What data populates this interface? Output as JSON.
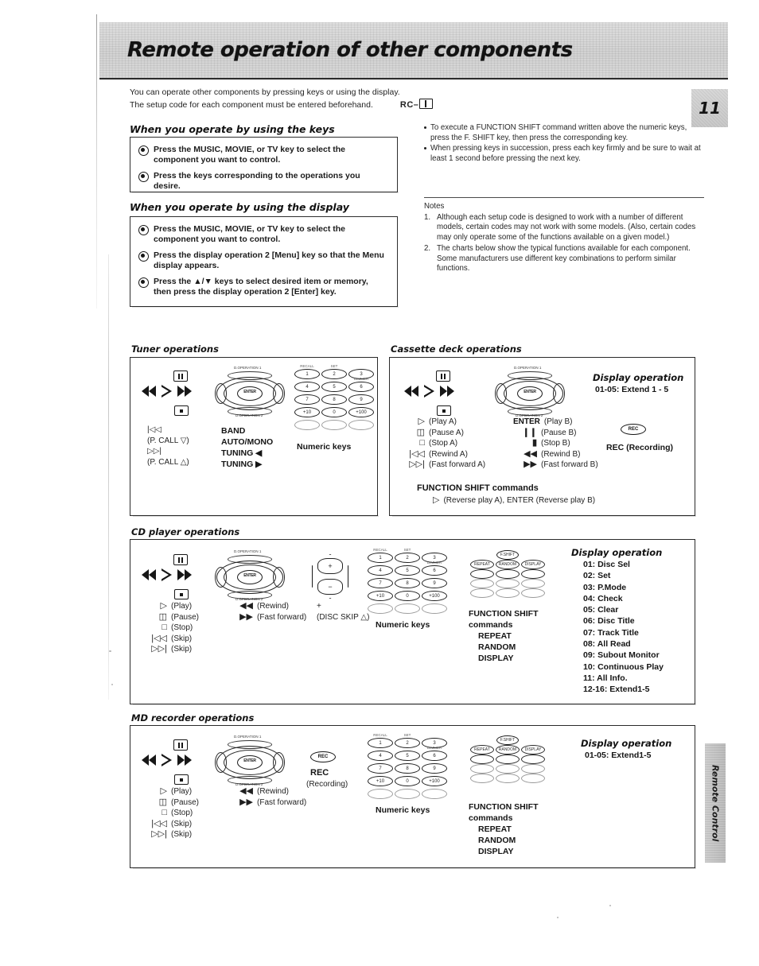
{
  "page": {
    "banner_title": "Remote operation of other components",
    "page_number": "11",
    "side_tab": "Remote Control"
  },
  "intro": {
    "line1": "You can operate other components by pressing keys or using the display.",
    "line2": "The setup code for each component must be entered beforehand.",
    "rc_code": "RC–"
  },
  "keys_section": {
    "title": "When you operate by using the keys",
    "steps": [
      "Press the MUSIC, MOVIE, or TV key to select the component you want to control.",
      "Press the keys corresponding to the operations you desire."
    ]
  },
  "display_section": {
    "title": "When you operate by using the display",
    "steps": [
      "Press the MUSIC, MOVIE, or TV key to select the component you want to control.",
      "Press the display operation 2 [Menu] key so that the Menu display appears.",
      "Press the ▲/▼ keys to select desired item or memory, then press the display operation 2 [Enter] key."
    ]
  },
  "right_notes": {
    "bullets": [
      "To execute a FUNCTION SHIFT command written above the numeric keys, press the F. SHIFT key, then press the corresponding key.",
      "When pressing keys in succession, press each key firmly and be sure to wait at least 1 second before pressing the next key."
    ],
    "notes_heading": "Notes",
    "notes": [
      {
        "n": "1.",
        "text": "Although each setup code is designed to work with a number of different models, certain codes may not work with some models.  (Also, certain codes may only operate some of the functions available on a given model.)"
      },
      {
        "n": "2.",
        "text": "The charts below show the typical functions available for each component.  Some manufacturers use different key combinations to perform similar functions."
      }
    ]
  },
  "tuner": {
    "label": "Tuner operations",
    "left_list": [
      "|◁◁",
      "(P. CALL ▽)",
      "▷▷|",
      "(P. CALL △)"
    ],
    "center_list": [
      "BAND",
      "AUTO/MONO",
      "TUNING ◀",
      "TUNING ▶"
    ],
    "numeric_caption": "Numeric keys"
  },
  "cassette": {
    "label": "Cassette deck operations",
    "col_a": [
      {
        "icon": "play",
        "text": "(Play A)"
      },
      {
        "icon": "pause",
        "text": "(Pause A)"
      },
      {
        "icon": "stop",
        "text": "(Stop A)"
      },
      {
        "icon": "rewind",
        "text": "(Rewind A)"
      },
      {
        "icon": "ffwd",
        "text": "(Fast forward A)"
      }
    ],
    "col_b": [
      {
        "icon": "enter",
        "label": "ENTER",
        "text": "(Play B)"
      },
      {
        "icon": "pause2",
        "text": "(Pause B)"
      },
      {
        "icon": "stop2",
        "text": "(Stop B)"
      },
      {
        "icon": "rewind2",
        "text": "(Rewind B)"
      },
      {
        "icon": "ffwd2",
        "text": "(Fast forward B)"
      }
    ],
    "rec_badge": "REC",
    "rec_caption": "REC (Recording)",
    "fshift_title": "FUNCTION SHIFT commands",
    "fshift_line": "(Reverse play A), ENTER (Reverse play B)",
    "display_title": "Display operation",
    "display_sub": "01-05: Extend 1 - 5"
  },
  "cd": {
    "label": "CD player operations",
    "col_a": [
      {
        "icon": "play",
        "text": "(Play)"
      },
      {
        "icon": "pause",
        "text": "(Pause)"
      },
      {
        "icon": "stop",
        "text": "(Stop)"
      },
      {
        "icon": "skipb",
        "text": "(Skip)"
      },
      {
        "icon": "skipf",
        "text": "(Skip)"
      }
    ],
    "col_b": [
      {
        "icon": "rewind2",
        "text": "(Rewind)"
      },
      {
        "icon": "ffwd2",
        "text": "(Fast forward)"
      }
    ],
    "disc_skip_plus": "+",
    "disc_skip_caption": "(DISC SKIP △)",
    "numeric_caption": "Numeric keys",
    "fshift_lines": [
      "FUNCTION SHIFT",
      "commands",
      "REPEAT",
      "RANDOM",
      "DISPLAY"
    ],
    "display_title": "Display operation",
    "display_items": [
      "01: Disc Sel",
      "02: Set",
      "03: P.Mode",
      "04: Check",
      "05: Clear",
      "06: Disc Title",
      "07: Track Title",
      "08: All Read",
      "09: Subout Monitor",
      "10: Continuous Play",
      "11: All Info.",
      "12-16: Extend1-5"
    ]
  },
  "md": {
    "label": "MD recorder operations",
    "col_a": [
      {
        "icon": "play",
        "text": "(Play)"
      },
      {
        "icon": "pause",
        "text": "(Pause)"
      },
      {
        "icon": "stop",
        "text": "(Stop)"
      },
      {
        "icon": "skipb",
        "text": "(Skip)"
      },
      {
        "icon": "skipf",
        "text": "(Skip)"
      }
    ],
    "col_b": [
      {
        "icon": "rewind2",
        "text": "(Rewind)"
      },
      {
        "icon": "ffwd2",
        "text": "(Fast forward)"
      }
    ],
    "rec_badge": "REC",
    "rec_label": "REC",
    "rec_caption": "(Recording)",
    "numeric_caption": "Numeric keys",
    "fshift_lines": [
      "FUNCTION SHIFT",
      "commands",
      "REPEAT",
      "RANDOM",
      "DISPLAY"
    ],
    "display_title": "Display operation",
    "display_sub": "01-05: Extend1-5"
  },
  "keypad_rows": [
    [
      "1",
      "2",
      "3"
    ],
    [
      "4",
      "5",
      "6"
    ],
    [
      "7",
      "8",
      "9"
    ],
    [
      "+10",
      "0",
      "+100"
    ]
  ],
  "keypad_faint_row": [
    "",
    "",
    ""
  ],
  "fshift_keypad": {
    "top": "F.SHIFT",
    "r1": [
      "REPEAT",
      "RANDOM",
      "DISPLAY"
    ]
  }
}
